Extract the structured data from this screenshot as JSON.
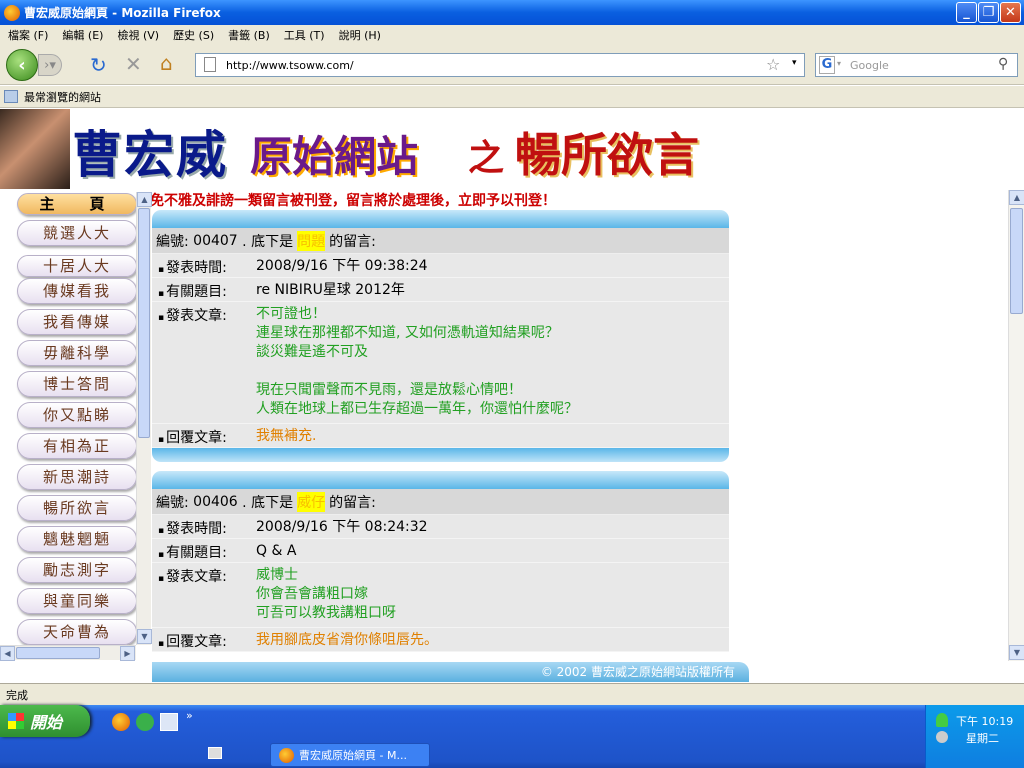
{
  "window": {
    "title": "曹宏威原始網頁 - Mozilla Firefox"
  },
  "menu": [
    "檔案 (F)",
    "編輯 (E)",
    "檢視 (V)",
    "歷史 (S)",
    "書籤 (B)",
    "工具 (T)",
    "說明 (H)"
  ],
  "nav": {
    "url": "http://www.tsoww.com/",
    "search_placeholder": "Google"
  },
  "bookmarks": {
    "label": "最常瀏覽的網站"
  },
  "banner": {
    "part1": "曹宏威",
    "part2": "原始網站",
    "part3": "之",
    "part4": "暢所欲言"
  },
  "notice": "免不雅及誹謗一類留言被刊登，留言將於處理後，立即予以刊登！",
  "sidebar": [
    "主　頁",
    "競選人大",
    "十居人大",
    "傳媒看我",
    "我看傳媒",
    "毋離科學",
    "博士答問",
    "你又點睇",
    "有相為正",
    "新思潮詩",
    "暢所欲言",
    "魑魅魍魎",
    "勵志測字",
    "與童同樂",
    "天命曹為"
  ],
  "labels": {
    "time": "發表時間:",
    "subject": "有關題目:",
    "article": "發表文章:",
    "reply": "回覆文章:",
    "prefix": "編號:",
    "mid": ". 底下是",
    "suffix": "的留言:"
  },
  "posts": [
    {
      "id": "00407",
      "name": "問題",
      "time": "2008/9/16 下午 09:38:24",
      "subject": "re NIBIRU星球 2012年",
      "article": [
        "不可證也！",
        "連星球在那裡都不知道, 又如何憑軌道知結果呢？",
        "談災難是遙不可及",
        "",
        "現在只聞雷聲而不見雨，還是放鬆心情吧！",
        "人類在地球上都已生存超過一萬年，你還怕什麼呢？"
      ],
      "reply": "我無補充."
    },
    {
      "id": "00406",
      "name": "威仔",
      "time": "2008/9/16 下午 08:24:32",
      "subject": "Q & A",
      "article": [
        "威博士",
        "你會吾會講粗口嫁",
        "可吾可以教我講粗口呀"
      ],
      "reply": "我用腳底皮省滑你條咀唇先。"
    }
  ],
  "footer": "© 2002 曹宏威之原始網站版權所有",
  "status": "完成",
  "taskbar": {
    "start": "開始",
    "item": "曹宏威原始網頁 - M...",
    "time": "下午 10:19",
    "day": "星期二"
  },
  "colors": {
    "accent": "#0a5fe0",
    "notice": "#cc0000",
    "article": "#22a022",
    "reply": "#e08000"
  }
}
